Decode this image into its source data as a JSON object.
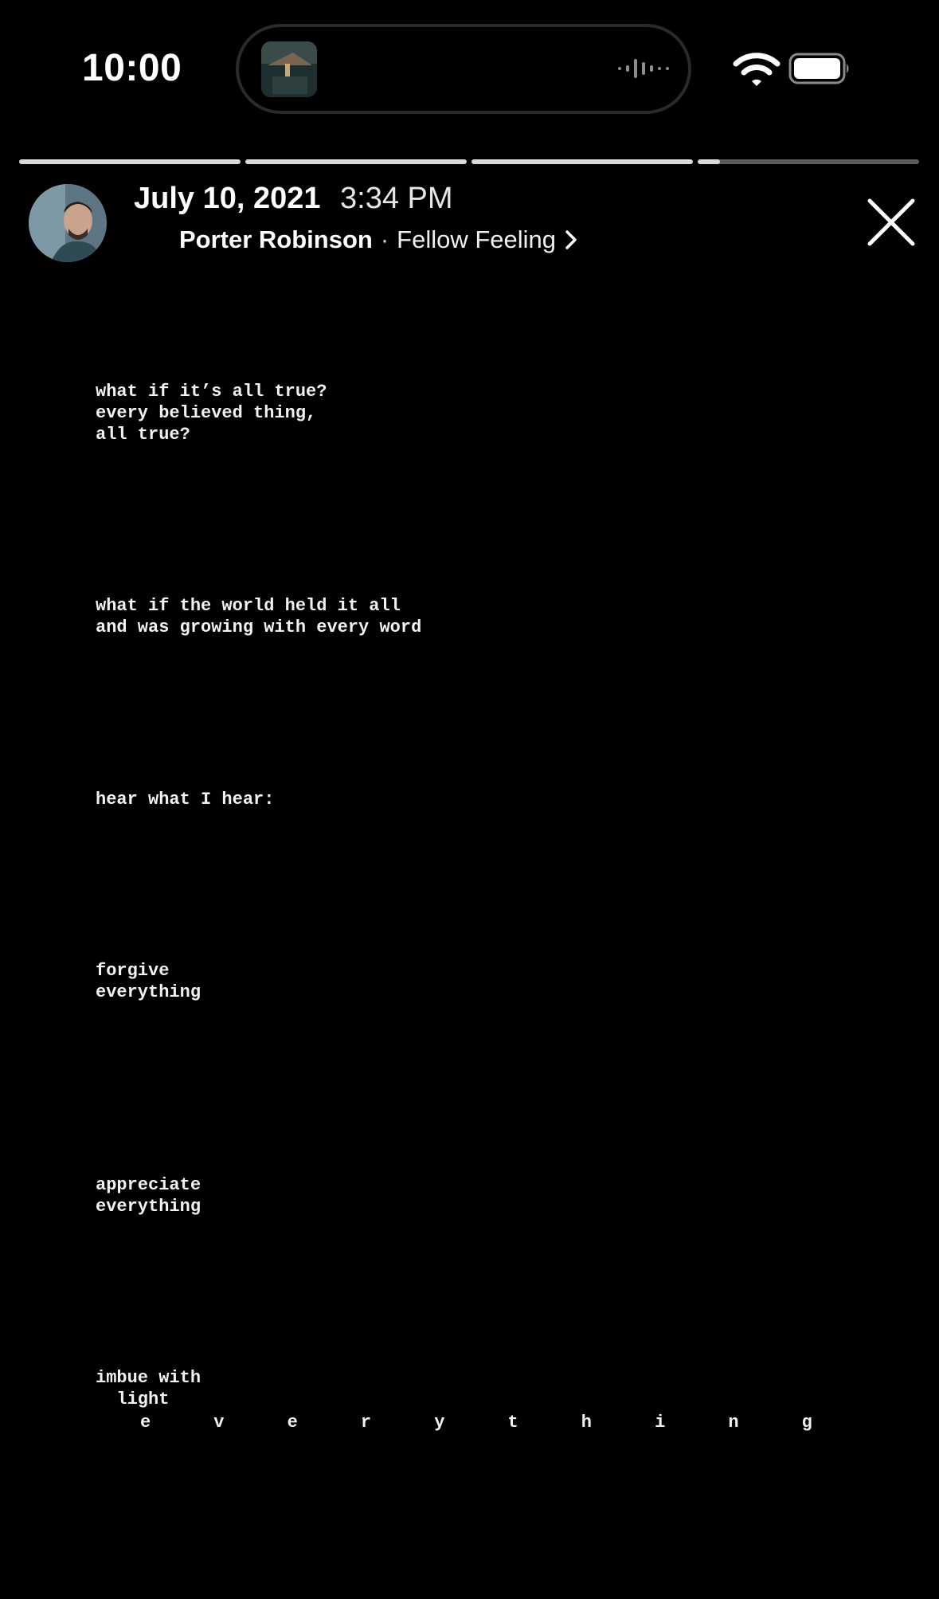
{
  "status_bar": {
    "time": "10:00",
    "battery_level": 1.0,
    "icons": [
      "now-playing-art",
      "audio-waveform-icon",
      "wifi-icon",
      "battery-icon"
    ]
  },
  "progress": {
    "segments": [
      1.0,
      1.0,
      1.0,
      0.1
    ]
  },
  "header": {
    "date": "July 10, 2021",
    "time": "3:34 PM",
    "artist": "Porter Robinson",
    "separator": "·",
    "song": "Fellow Feeling",
    "icons": [
      "avatar",
      "chevron-right-icon",
      "close-icon"
    ]
  },
  "lyrics": {
    "stanza_1": "what if it’s all true?\nevery believed thing,\nall true?",
    "stanza_2": "what if the world held it all\nand was growing with every word",
    "stanza_3": "hear what I hear:",
    "stanza_4": "forgive\neverything",
    "stanza_5": "appreciate\neverything",
    "stanza_6": "imbue with\n  light",
    "spread_letters": [
      "e",
      "v",
      "e",
      "r",
      "y",
      "t",
      "h",
      "i",
      "n",
      "g"
    ]
  },
  "colors": {
    "background": "#000000",
    "text": "#ffffff",
    "progress_filled": "#d9d9d9",
    "progress_empty": "#5a5a5a"
  }
}
